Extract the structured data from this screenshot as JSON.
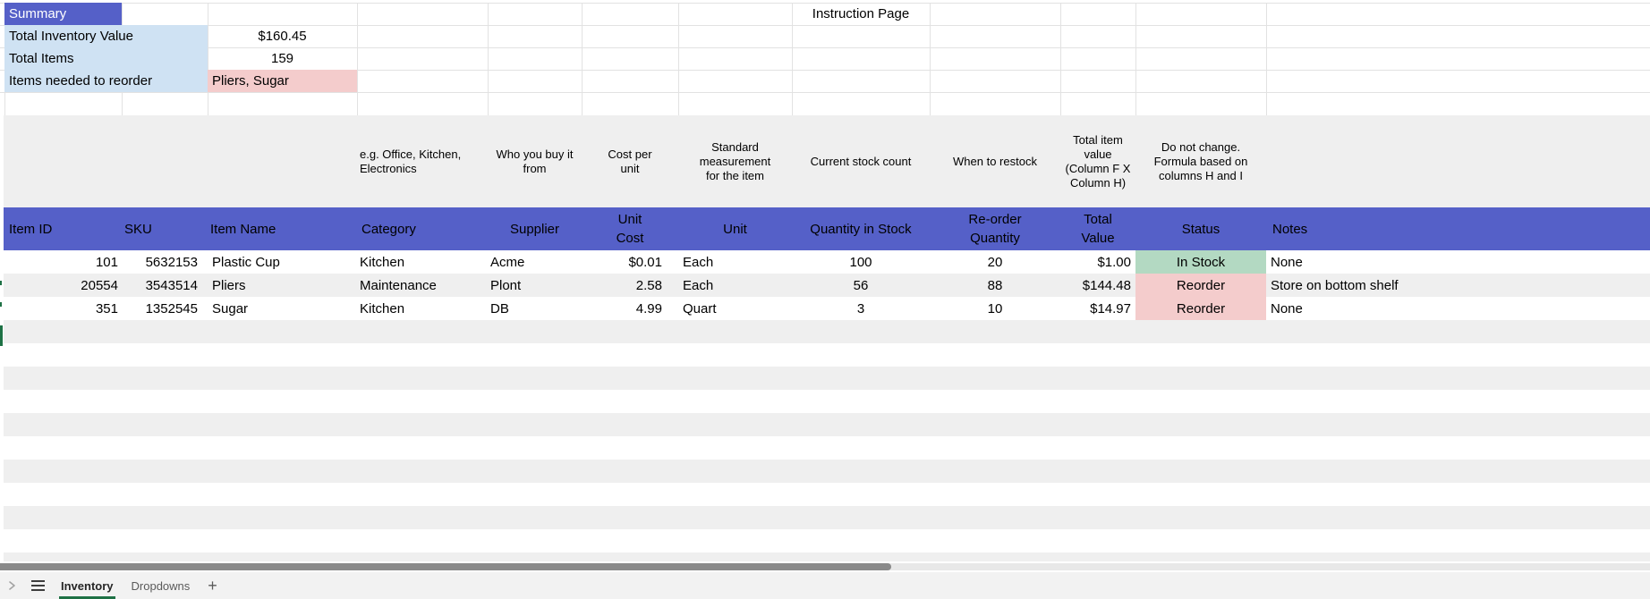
{
  "summary": {
    "title": "Summary",
    "rows": [
      {
        "label": "Total Inventory Value",
        "value": "$160.45"
      },
      {
        "label": "Total Items",
        "value": "159"
      },
      {
        "label": "Items needed to reorder",
        "value": "Pliers, Sugar"
      }
    ]
  },
  "instruction_page_label": "Instruction Page",
  "column_descriptions": {
    "category": "e.g. Office, Kitchen,\nElectronics",
    "supplier": "Who you buy it\nfrom",
    "unit_cost": "Cost per\nunit",
    "unit": "Standard\nmeasurement\nfor the item",
    "quantity": "Current stock count",
    "reorder": "When to restock",
    "total_value": "Total item\nvalue\n(Column F X\nColumn H)",
    "status": "Do not change.\nFormula based on\ncolumns H and I"
  },
  "table": {
    "headers": [
      "Item ID",
      "SKU",
      "Item Name",
      "Category",
      "Supplier",
      "Unit\nCost",
      "Unit",
      "Quantity in Stock",
      "Re-order\nQuantity",
      "Total\nValue",
      "Status",
      "Notes"
    ],
    "rows": [
      {
        "item_id": "101",
        "sku": "5632153",
        "item_name": "Plastic Cup",
        "category": "Kitchen",
        "supplier": "Acme",
        "unit_cost": "$0.01",
        "unit": "Each",
        "qty": "100",
        "reorder_qty": "20",
        "total_value": "$1.00",
        "status": "In Stock",
        "notes": "None"
      },
      {
        "item_id": "20554",
        "sku": "3543514",
        "item_name": "Pliers",
        "category": "Maintenance",
        "supplier": "Plont",
        "unit_cost": "2.58",
        "unit": "Each",
        "qty": "56",
        "reorder_qty": "88",
        "total_value": "$144.48",
        "status": "Reorder",
        "notes": "Store on bottom shelf"
      },
      {
        "item_id": "351",
        "sku": "1352545",
        "item_name": "Sugar",
        "category": "Kitchen",
        "supplier": "DB",
        "unit_cost": "4.99",
        "unit": "Quart",
        "qty": "3",
        "reorder_qty": "10",
        "total_value": "$14.97",
        "status": "Reorder",
        "notes": "None"
      }
    ]
  },
  "sheet_tabs": {
    "tabs": [
      {
        "label": "Inventory",
        "active": true
      },
      {
        "label": "Dropdowns",
        "active": false
      }
    ],
    "add_label": "+"
  },
  "colors": {
    "header_blue": "#5560c8",
    "summary_label_blue": "#cfe2f3",
    "reorder_pink": "#f4cccc",
    "in_stock_green": "#b3d9c2",
    "band_gray": "#efefef",
    "active_tab_green": "#1e7145",
    "scrollbar_thumb_gray": "#8a8a8a"
  }
}
